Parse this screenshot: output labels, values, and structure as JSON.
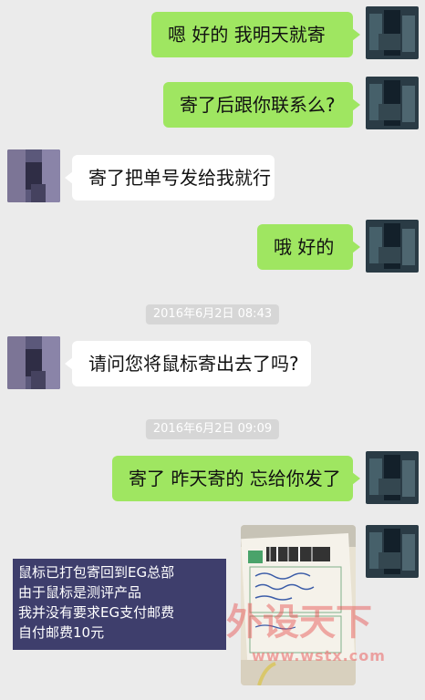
{
  "chat": {
    "messages": [
      {
        "side": "me",
        "text": "嗯  好的  我明天就寄"
      },
      {
        "side": "me",
        "text": "寄了后跟你联系么?"
      },
      {
        "side": "them",
        "text": "寄了把单号发给我就行"
      },
      {
        "side": "me",
        "text": "哦 好的"
      },
      {
        "side": "them",
        "text": "请问您将鼠标寄出去了吗?"
      },
      {
        "side": "me",
        "text": "寄了  昨天寄的 忘给你发了"
      }
    ],
    "timestamps": [
      "2016年6月2日  08:43",
      "2016年6月2日  09:09"
    ],
    "photo": {
      "description": "shipping receipt photo"
    }
  },
  "annotation": {
    "lines": [
      "鼠标已打包寄回到EG总部",
      "由于鼠标是测评产品",
      "我并没有要求EG支付邮费",
      "自付邮费10元"
    ]
  },
  "watermark": {
    "brand": "外设天下",
    "url": "www.wstx.com"
  },
  "colors": {
    "background": "#ebebeb",
    "my_bubble": "#9fe661",
    "their_bubble": "#ffffff",
    "timestamp_bg": "#d6d6d6"
  }
}
